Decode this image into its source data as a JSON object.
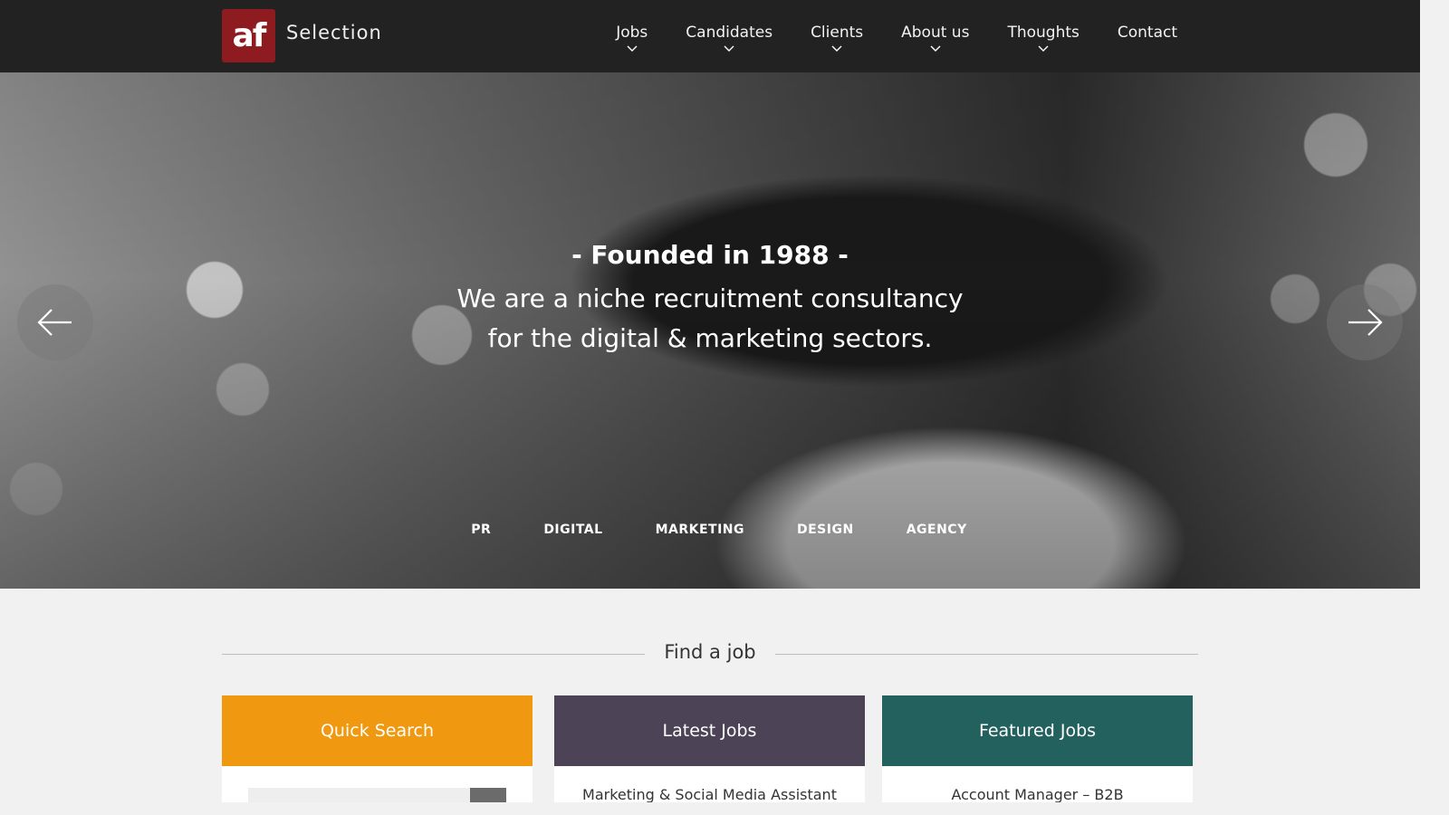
{
  "header": {
    "logo_text": "af",
    "brand": "Selection",
    "nav": [
      {
        "label": "Jobs"
      },
      {
        "label": "Candidates"
      },
      {
        "label": "Clients"
      },
      {
        "label": "About us"
      },
      {
        "label": "Thoughts"
      },
      {
        "label": "Contact"
      }
    ]
  },
  "hero": {
    "title": "- Founded in 1988 -",
    "subtitle_line1": "We are a niche recruitment consultancy",
    "subtitle_line2": "for the digital & marketing sectors.",
    "sectors": [
      "PR",
      "DIGITAL",
      "MARKETING",
      "DESIGN",
      "AGENCY"
    ],
    "prev_icon": "arrow-left-icon",
    "next_icon": "arrow-right-icon"
  },
  "find_job": {
    "title": "Find a job",
    "cards": [
      {
        "title": "Quick Search",
        "color": "#f0980f"
      },
      {
        "title": "Latest Jobs",
        "color": "#4d4356",
        "first_item": "Marketing & Social Media Assistant"
      },
      {
        "title": "Featured Jobs",
        "color": "#23615f",
        "first_item": "Account Manager – B2B"
      }
    ]
  },
  "colors": {
    "header_bg": "#222222",
    "logo_bg": "#8e1b1f",
    "page_bg": "#f1f1f1"
  }
}
